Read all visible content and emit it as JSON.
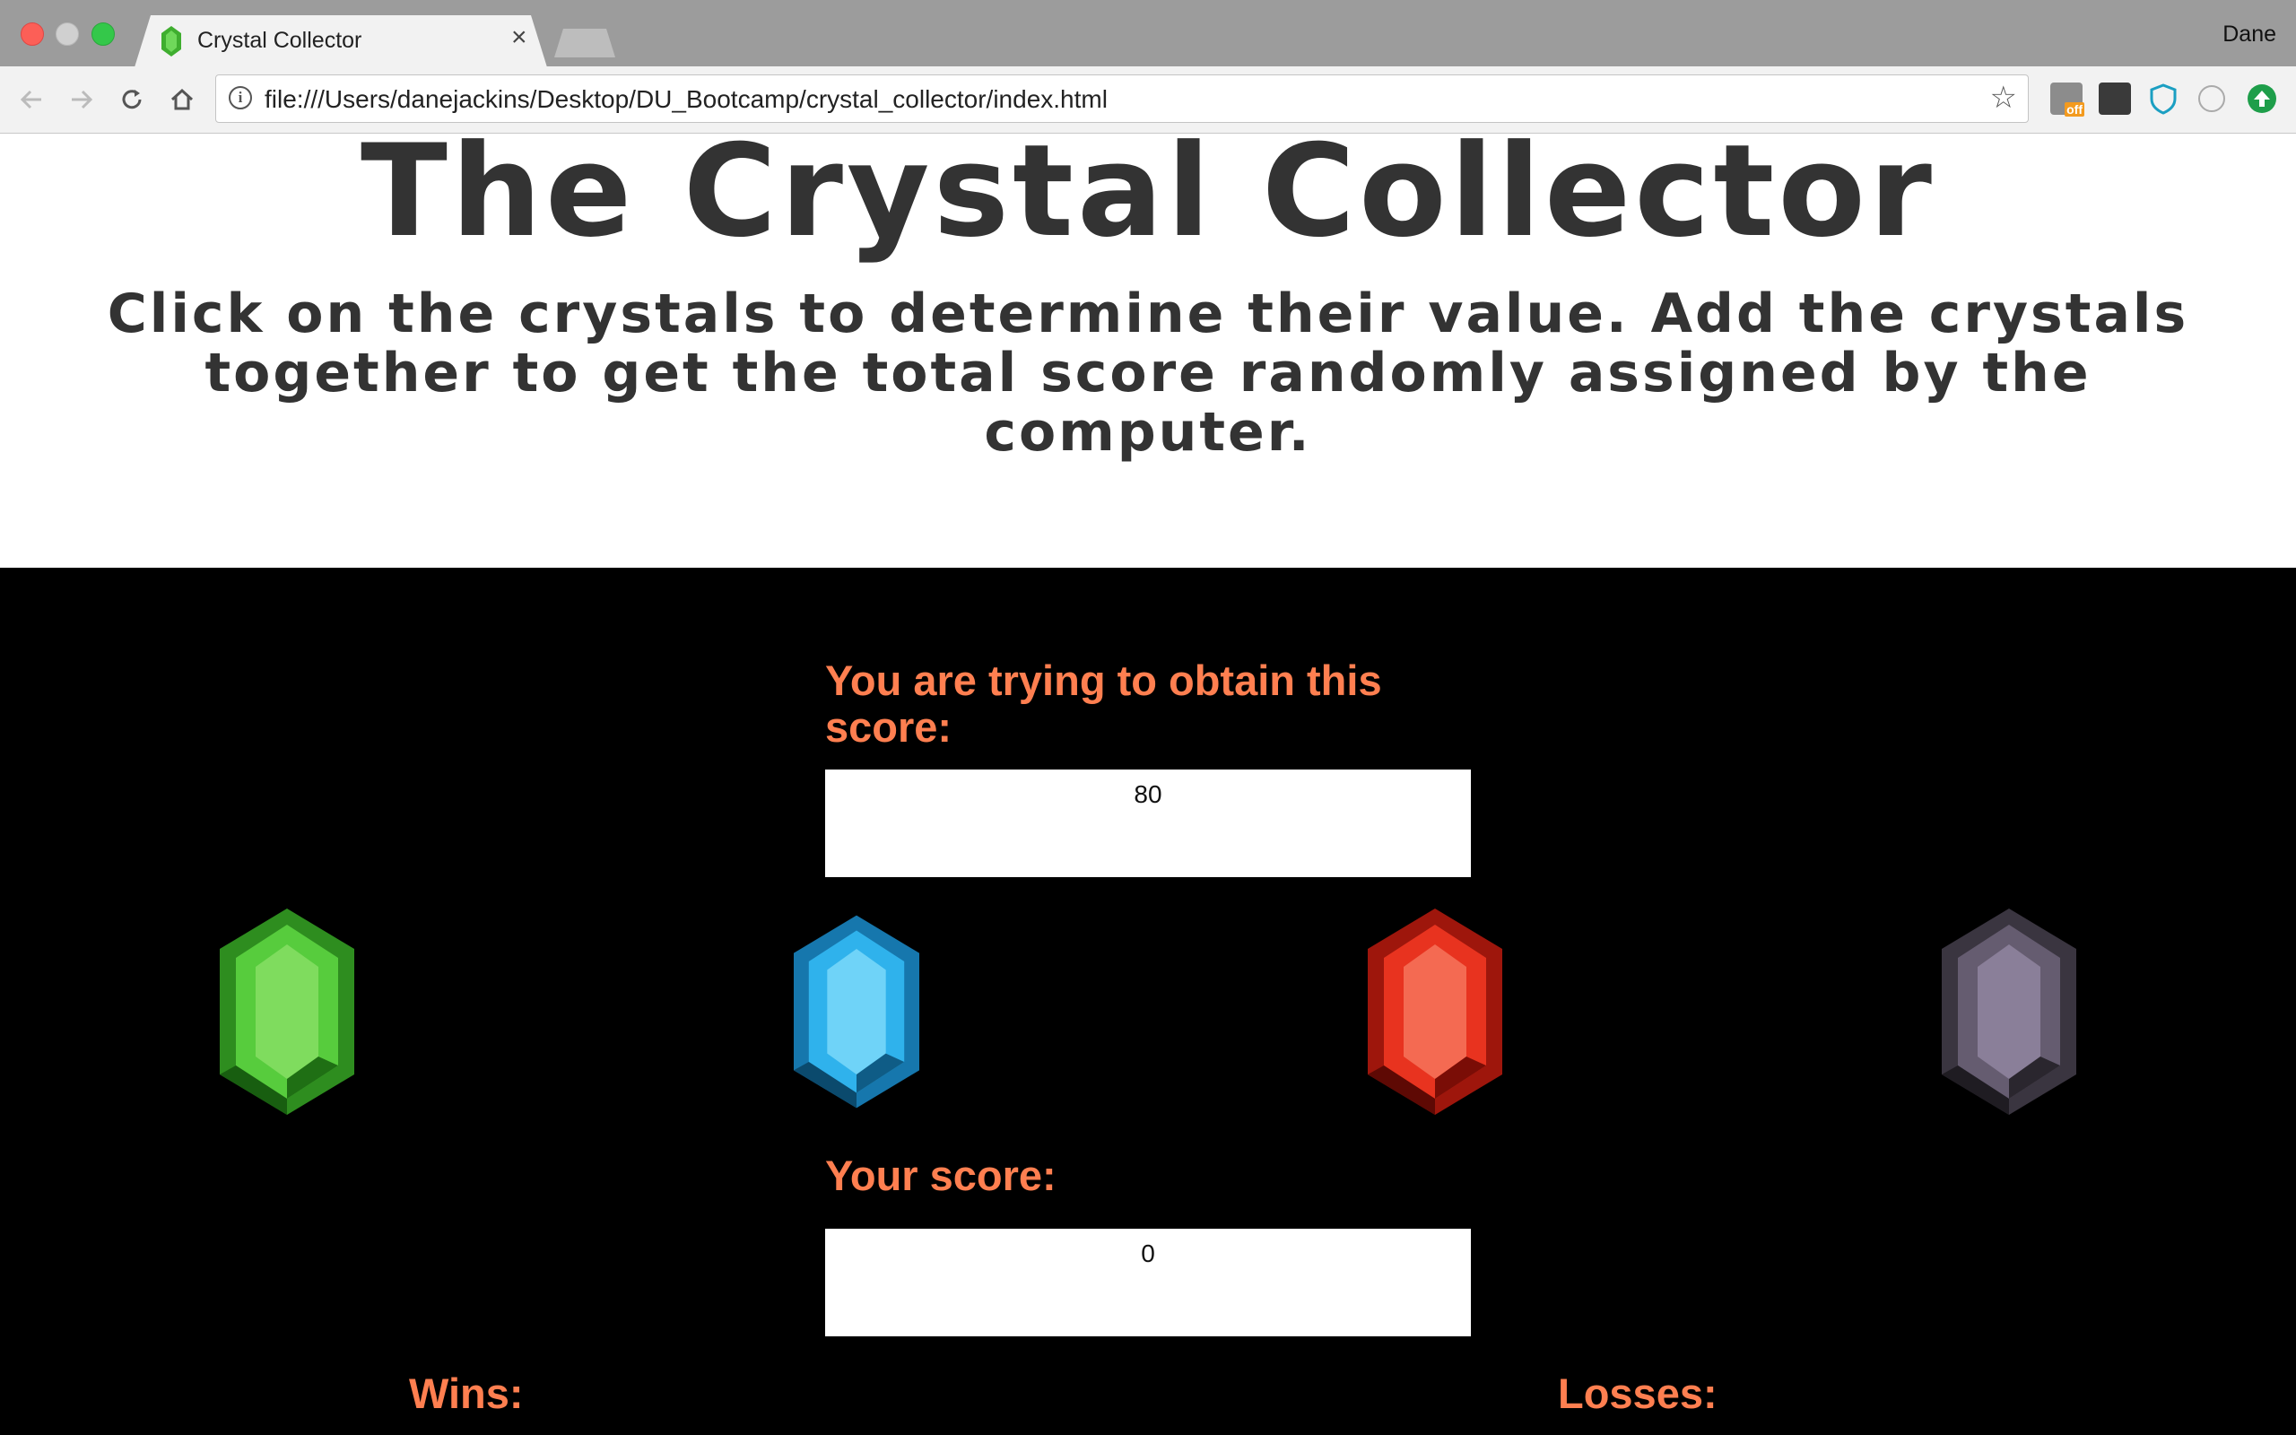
{
  "browser": {
    "tab_title": "Crystal Collector",
    "tab_close": "×",
    "profile_name": "Dane",
    "url": "file:///Users/danejackins/Desktop/DU_Bootcamp/crystal_collector/index.html",
    "info_glyph": "i",
    "bookmark_glyph": "☆",
    "extensions": [
      "off-badge-icon",
      "wiki-icon",
      "shield-icon",
      "code-icon",
      "update-icon"
    ]
  },
  "page": {
    "title": "The Crystal Collector",
    "instructions": "Click on the crystals to determine their value. Add the crystals together to get the total score randomly assigned by the computer."
  },
  "game": {
    "target_label": "You are trying to obtain this score:",
    "target_value": "80",
    "score_label": "Your score:",
    "score_value": "0",
    "wins_label": "Wins:",
    "losses_label": "Losses:",
    "crystals": [
      {
        "name": "green-crystal",
        "color": "#4cc23a"
      },
      {
        "name": "blue-crystal",
        "color": "#2fa9e6"
      },
      {
        "name": "red-crystal",
        "color": "#e8331f"
      },
      {
        "name": "purple-crystal",
        "color": "#6d6478"
      }
    ]
  },
  "colors": {
    "accent": "#ff7f50",
    "heading_text": "#333333",
    "game_background": "#000000"
  }
}
